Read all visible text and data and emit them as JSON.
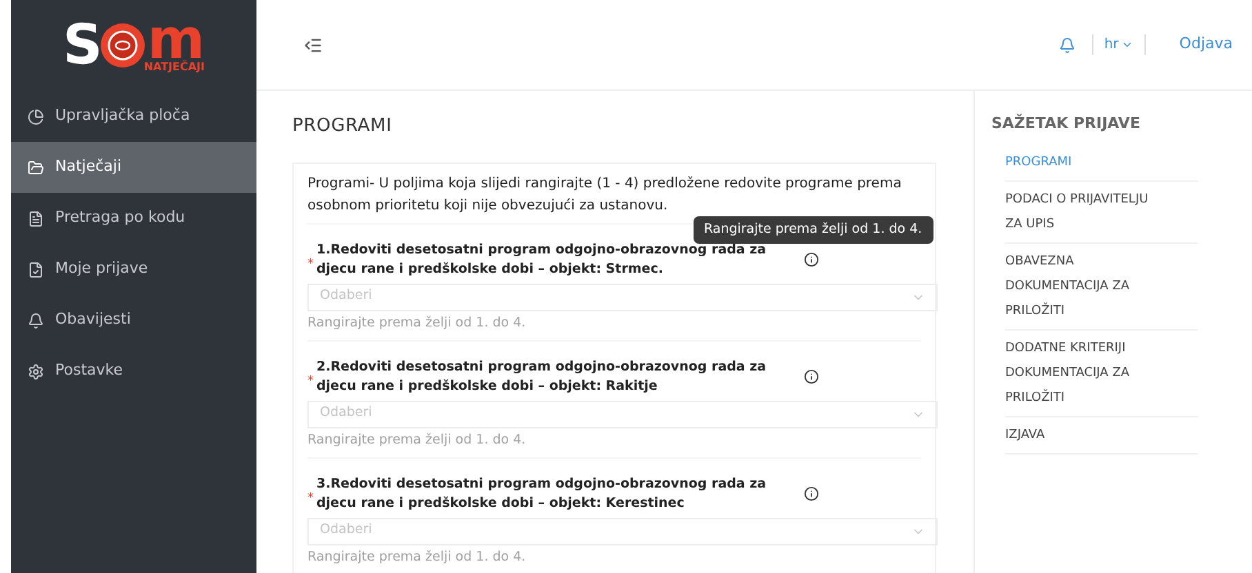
{
  "logo": {
    "left": "S",
    "right": "m",
    "subtitle": "NATJEČAJI"
  },
  "sidebar": {
    "items": [
      {
        "label": "Upravljačka ploča",
        "kind": "dashboard",
        "selected": false
      },
      {
        "label": "Natječaji",
        "kind": "folder",
        "selected": true
      },
      {
        "label": "Pretraga po kodu",
        "kind": "file",
        "selected": false
      },
      {
        "label": "Moje prijave",
        "kind": "doc",
        "selected": false
      },
      {
        "label": "Obavijesti",
        "kind": "bell",
        "selected": false
      },
      {
        "label": "Postavke",
        "kind": "gear",
        "selected": false
      }
    ]
  },
  "header": {
    "language": "hr",
    "logout": "Odjava"
  },
  "main": {
    "title": "PROGRAMI",
    "intro": "Programi- U poljima koja slijedi rangirajte (1 - 4) predložene redovite programe prema osobnom prioritetu koji nije obvezujući za ustanovu.",
    "fields": [
      {
        "label": "1.Redoviti desetosatni program odgojno-obrazovnog rada za djecu rane i predškolske dobi – objekt: Strmec.",
        "required_mark": "*",
        "placeholder": "Odaberi",
        "hint": "Rangirajte prema želji od 1. do 4.",
        "tooltip": "Rangirajte prema želji od 1. do 4."
      },
      {
        "label": "2.Redoviti desetosatni program odgojno-obrazovnog rada za djecu rane i predškolske dobi – objekt: Rakitje",
        "required_mark": "*",
        "placeholder": "Odaberi",
        "hint": "Rangirajte prema želji od 1. do 4."
      },
      {
        "label": "3.Redoviti desetosatni program odgojno-obrazovnog rada za djecu rane i predškolske dobi – objekt: Kerestinec",
        "required_mark": "*",
        "placeholder": "Odaberi",
        "hint": "Rangirajte prema želji od 1. do 4."
      }
    ]
  },
  "summary": {
    "title": "SAŽETAK PRIJAVE",
    "items": [
      {
        "label": "PROGRAMI",
        "selected": true
      },
      {
        "label": "PODACI O PRIJAVITELJU ZA UPIS",
        "selected": false
      },
      {
        "label": "OBAVEZNA DOKUMENTACIJA ZA PRILOŽITI",
        "selected": false
      },
      {
        "label": "DODATNE KRITERIJI DOKUMENTACIJA ZA PRILOŽITI",
        "selected": false
      },
      {
        "label": "IZJAVA",
        "selected": false
      }
    ]
  }
}
